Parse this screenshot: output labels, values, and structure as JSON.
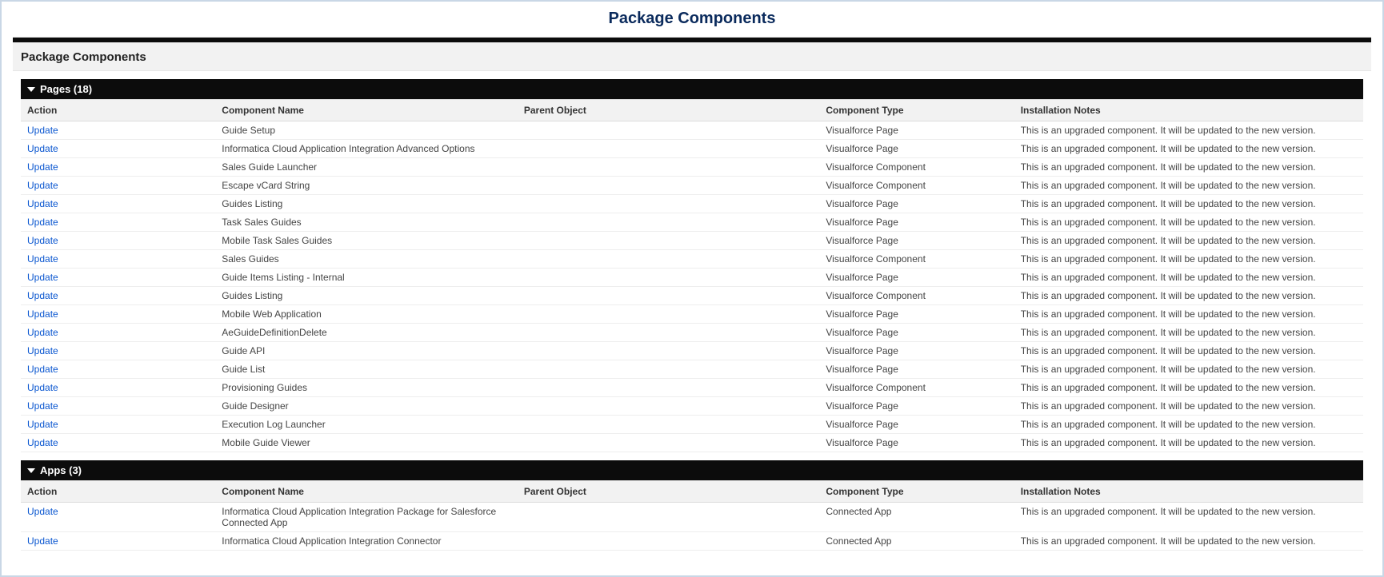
{
  "page": {
    "title": "Package Components",
    "panel_header": "Package Components"
  },
  "columns": {
    "action": "Action",
    "component_name": "Component Name",
    "parent_object": "Parent Object",
    "component_type": "Component Type",
    "installation_notes": "Installation Notes"
  },
  "note_text": "This is an upgraded component. It will be updated to the new version.",
  "action_text": "Update",
  "sections": [
    {
      "title": "Pages (18)",
      "rows": [
        {
          "name": "Guide Setup",
          "parent": "",
          "type": "Visualforce Page"
        },
        {
          "name": "Informatica Cloud Application Integration Advanced Options",
          "parent": "",
          "type": "Visualforce Page"
        },
        {
          "name": "Sales Guide Launcher",
          "parent": "",
          "type": "Visualforce Component"
        },
        {
          "name": "Escape vCard String",
          "parent": "",
          "type": "Visualforce Component"
        },
        {
          "name": "Guides Listing",
          "parent": "",
          "type": "Visualforce Page"
        },
        {
          "name": "Task Sales Guides",
          "parent": "",
          "type": "Visualforce Page"
        },
        {
          "name": "Mobile Task Sales Guides",
          "parent": "",
          "type": "Visualforce Page"
        },
        {
          "name": "Sales Guides",
          "parent": "",
          "type": "Visualforce Component"
        },
        {
          "name": "Guide Items Listing - Internal",
          "parent": "",
          "type": "Visualforce Page"
        },
        {
          "name": "Guides Listing",
          "parent": "",
          "type": "Visualforce Component"
        },
        {
          "name": "Mobile Web Application",
          "parent": "",
          "type": "Visualforce Page"
        },
        {
          "name": "AeGuideDefinitionDelete",
          "parent": "",
          "type": "Visualforce Page"
        },
        {
          "name": "Guide API",
          "parent": "",
          "type": "Visualforce Page"
        },
        {
          "name": "Guide List",
          "parent": "",
          "type": "Visualforce Page"
        },
        {
          "name": "Provisioning Guides",
          "parent": "",
          "type": "Visualforce Component"
        },
        {
          "name": "Guide Designer",
          "parent": "",
          "type": "Visualforce Page"
        },
        {
          "name": "Execution Log Launcher",
          "parent": "",
          "type": "Visualforce Page"
        },
        {
          "name": "Mobile Guide Viewer",
          "parent": "",
          "type": "Visualforce Page"
        }
      ]
    },
    {
      "title": "Apps (3)",
      "rows": [
        {
          "name": "Informatica Cloud Application Integration Package for Salesforce Connected App",
          "parent": "",
          "type": "Connected App"
        },
        {
          "name": "Informatica Cloud Application Integration Connector",
          "parent": "",
          "type": "Connected App"
        }
      ]
    }
  ]
}
